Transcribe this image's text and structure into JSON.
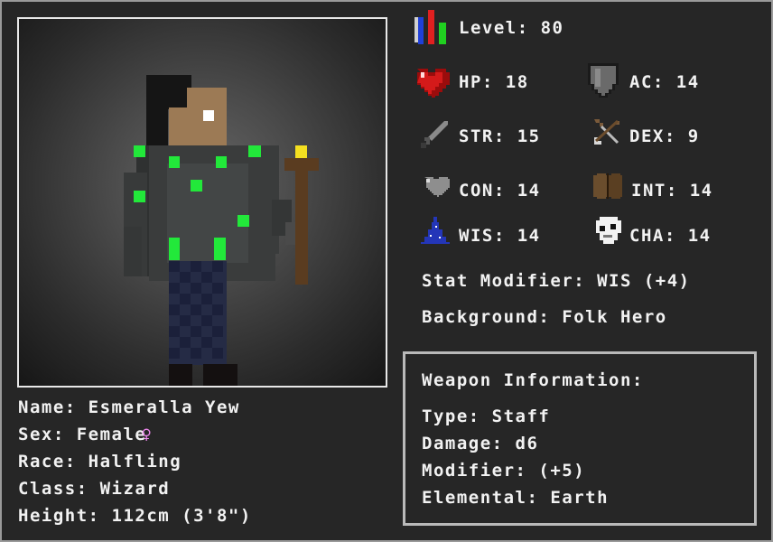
{
  "level": {
    "label": "Level:",
    "value": "80",
    "icon": "bar-chart-icon"
  },
  "stats": {
    "hp": {
      "label": "HP:",
      "value": "18",
      "icon": "heart-icon"
    },
    "ac": {
      "label": "AC:",
      "value": "14",
      "icon": "shield-icon"
    },
    "str": {
      "label": "STR:",
      "value": "15",
      "icon": "sword-icon"
    },
    "dex": {
      "label": "DEX:",
      "value": "9",
      "icon": "bow-icon"
    },
    "con": {
      "label": "CON:",
      "value": "14",
      "icon": "grey-heart-icon"
    },
    "int": {
      "label": "INT:",
      "value": "14",
      "icon": "book-icon"
    },
    "wis": {
      "label": "WIS:",
      "value": "14",
      "icon": "wizard-hat-icon"
    },
    "cha": {
      "label": "CHA:",
      "value": "14",
      "icon": "mask-icon"
    }
  },
  "stat_modifier": {
    "label": "Stat Modifier:",
    "value": "WIS (+4)"
  },
  "background": {
    "label": "Background:",
    "value": "Folk Hero"
  },
  "character": {
    "name": {
      "label": "Name:",
      "value": "Esmeralla Yew"
    },
    "sex": {
      "label": "Sex:",
      "value": "Female",
      "icon": "female-symbol-icon",
      "icon_char": "♀"
    },
    "race": {
      "label": "Race:",
      "value": "Halfling"
    },
    "class": {
      "label": "Class:",
      "value": "Wizard"
    },
    "height": {
      "label": "Height:",
      "value": "112cm (3'8\")"
    }
  },
  "weapon": {
    "title": "Weapon Information:",
    "type": {
      "label": "Type:",
      "value": "Staff"
    },
    "damage": {
      "label": "Damage:",
      "value": "d6"
    },
    "modifier": {
      "label": "Modifier:",
      "value": "(+5)"
    },
    "elemental": {
      "label": "Elemental:",
      "value": "Earth"
    }
  },
  "colors": {
    "background": "#262626",
    "text": "#f2f2f2",
    "robe": "#3a3c3c",
    "gem_green": "#22e83a",
    "pants": "#1c2238",
    "skin": "#9c7a55",
    "hair": "#151515",
    "staff": "#5a3c20",
    "staff_gem": "#f5e020",
    "female_symbol": "#ee88ee"
  }
}
